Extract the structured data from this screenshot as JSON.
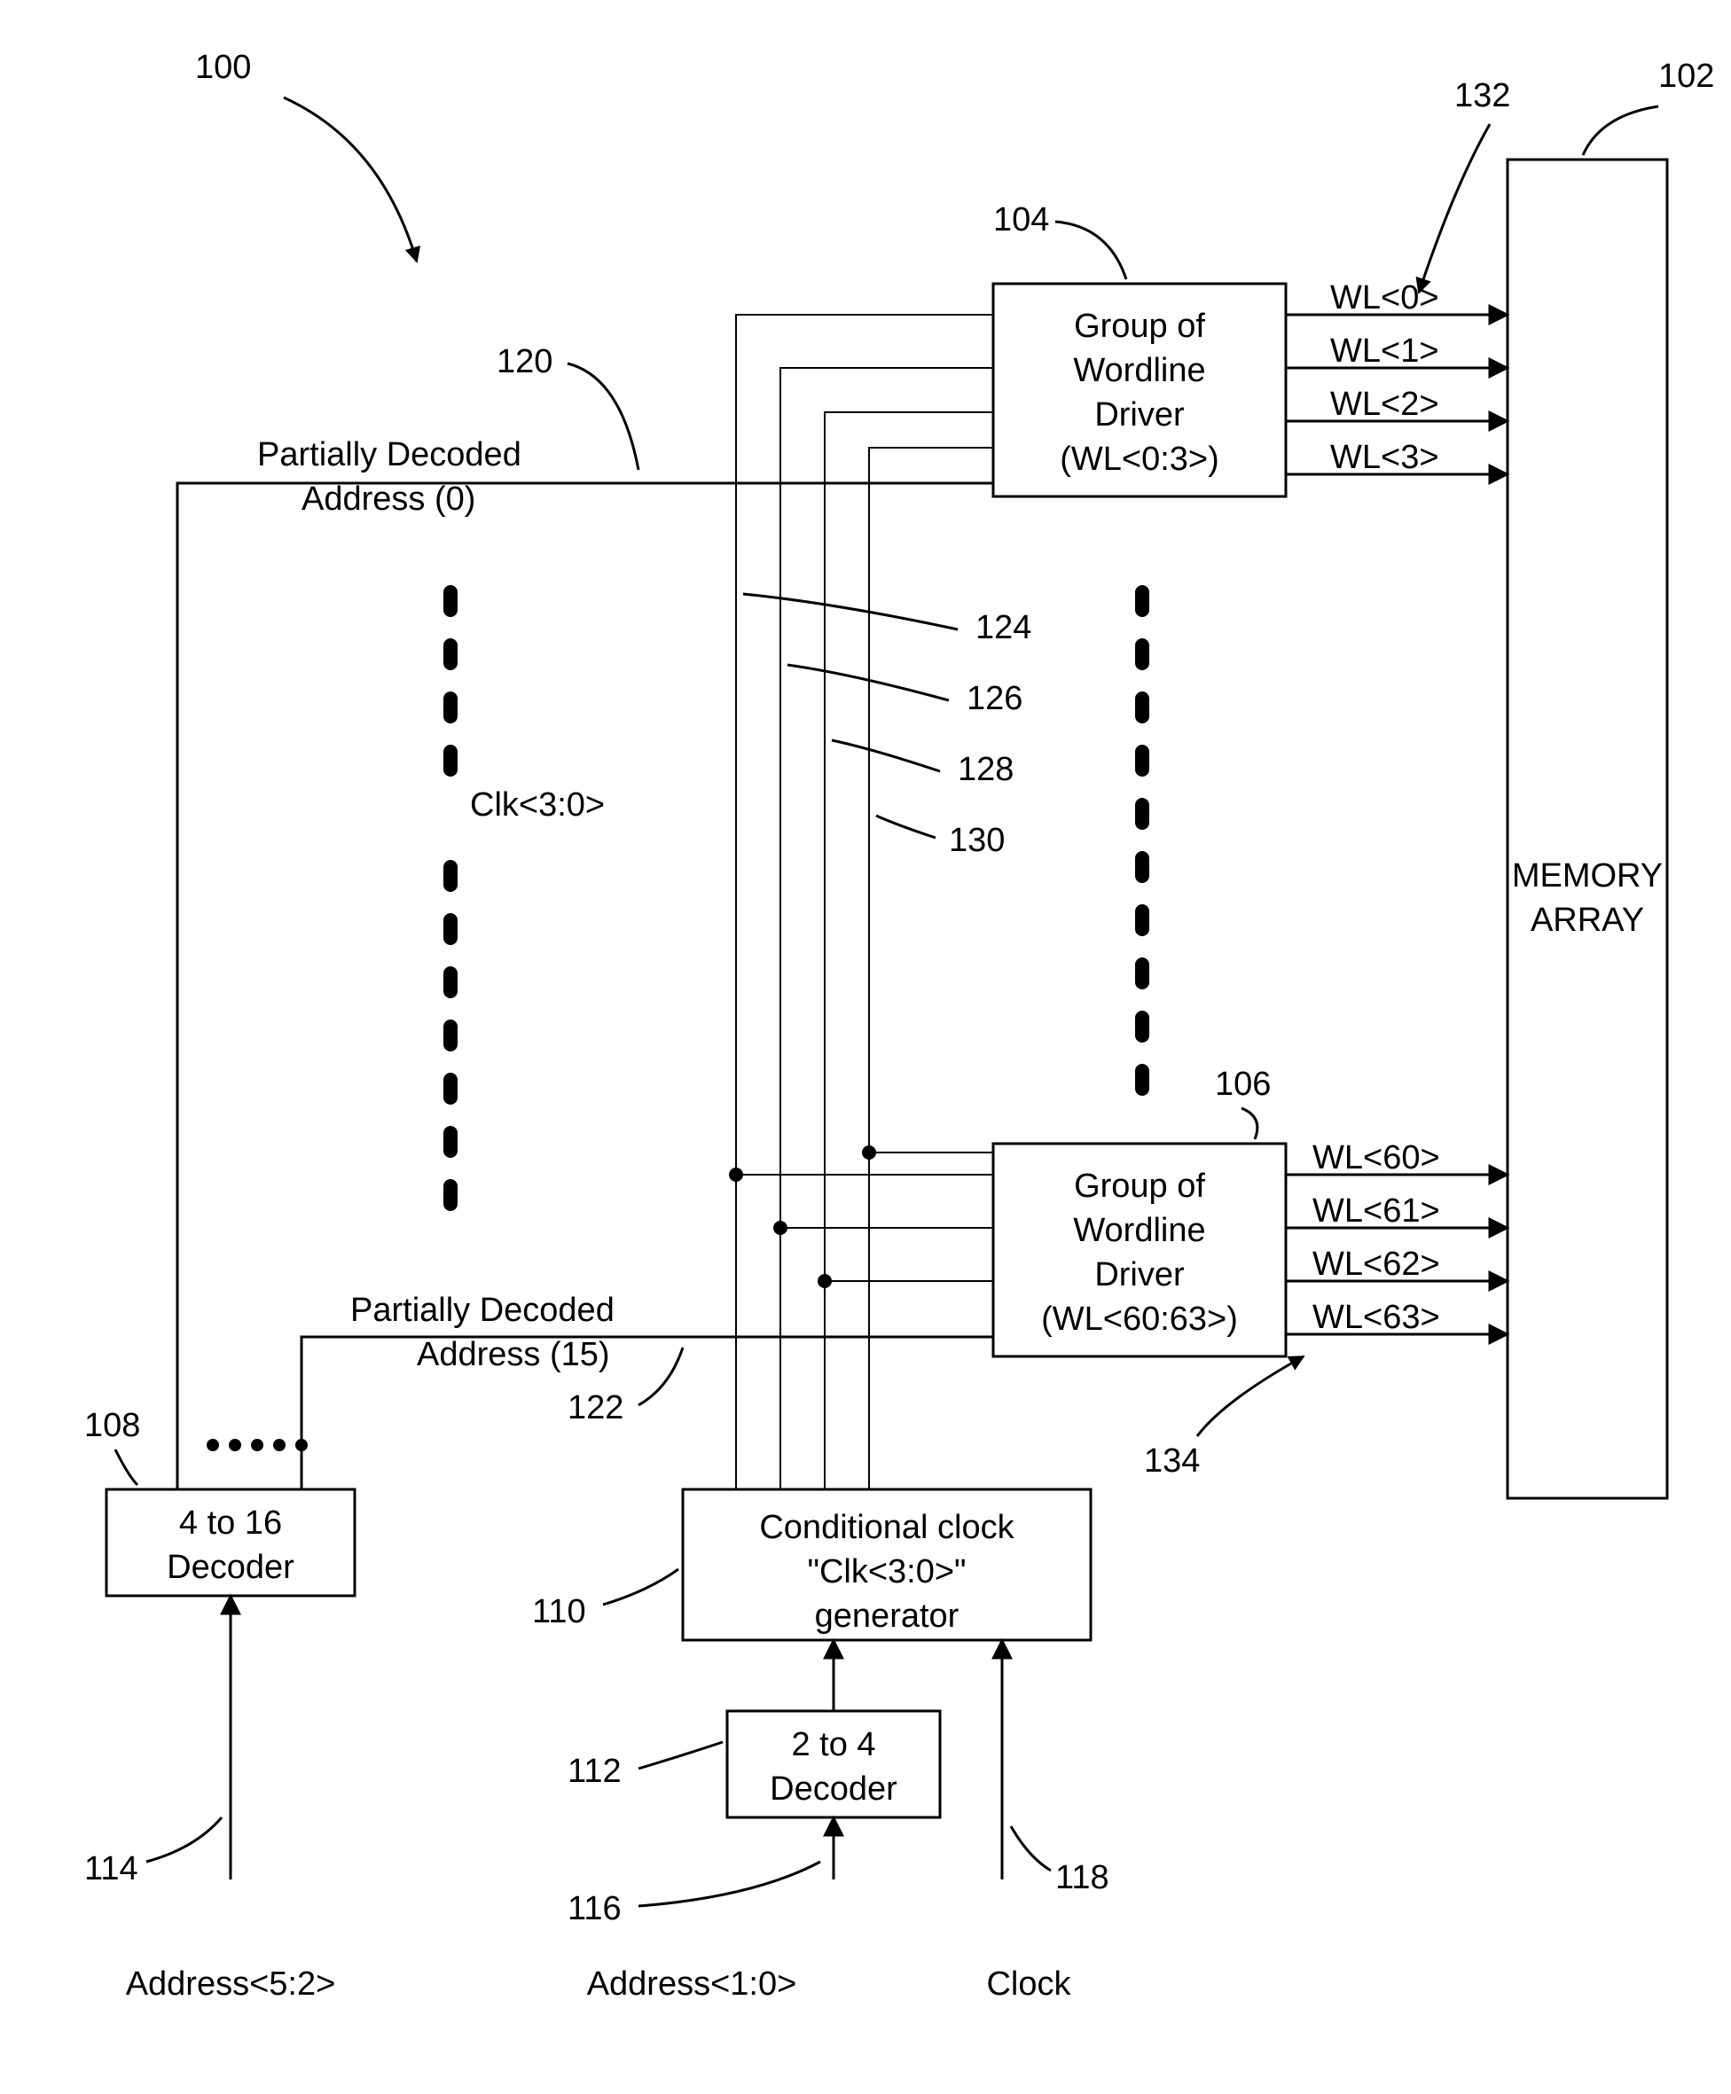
{
  "refs": {
    "r100": "100",
    "r102": "102",
    "r104": "104",
    "r106": "106",
    "r108": "108",
    "r110": "110",
    "r112": "112",
    "r114": "114",
    "r116": "116",
    "r118": "118",
    "r120": "120",
    "r122": "122",
    "r124": "124",
    "r126": "126",
    "r128": "128",
    "r130": "130",
    "r132": "132",
    "r134": "134"
  },
  "memory_array": {
    "l1": "MEMORY",
    "l2": "ARRAY"
  },
  "wl_top": {
    "l1": "Group of",
    "l2": "Wordline",
    "l3": "Driver",
    "l4": "(WL<0:3>)"
  },
  "wl_bot": {
    "l1": "Group of",
    "l2": "Wordline",
    "l3": "Driver",
    "l4": "(WL<60:63>)"
  },
  "wl_out": {
    "a": "WL<0>",
    "b": "WL<1>",
    "c": "WL<2>",
    "d": "WL<3>",
    "e": "WL<60>",
    "f": "WL<61>",
    "g": "WL<62>",
    "h": "WL<63>"
  },
  "decoder416": {
    "l1": "4 to 16",
    "l2": "Decoder"
  },
  "decoder24": {
    "l1": "2 to 4",
    "l2": "Decoder"
  },
  "clkgen": {
    "l1": "Conditional clock",
    "l2": "\"Clk<3:0>\"",
    "l3": "generator"
  },
  "labels": {
    "pda0_1": "Partially Decoded",
    "pda0_2": "Address (0)",
    "pda15_1": "Partially Decoded",
    "pda15_2": "Address (15)",
    "clk30": "Clk<3:0>",
    "addr52": "Address<5:2>",
    "addr10": "Address<1:0>",
    "clock": "Clock"
  }
}
